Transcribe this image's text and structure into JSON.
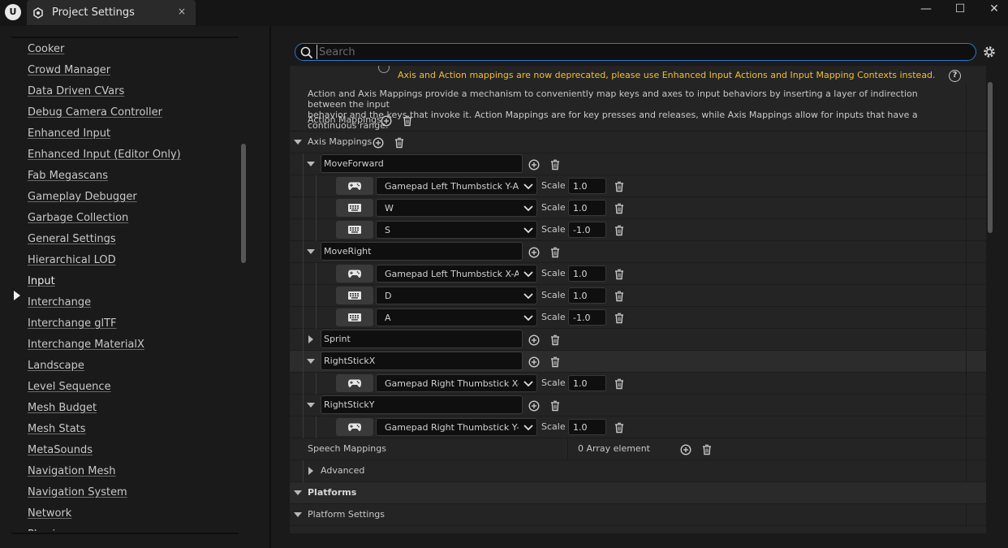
{
  "window": {
    "app_logo_text": "U",
    "tab_title": "Project Settings",
    "close_tab_glyph": "×",
    "minimize_glyph": "—",
    "maximize_glyph": "☐",
    "close_glyph": "✕"
  },
  "sidebar": {
    "selected": "Input",
    "items": [
      "Cooker",
      "Crowd Manager",
      "Data Driven CVars",
      "Debug Camera Controller",
      "Enhanced Input",
      "Enhanced Input (Editor Only)",
      "Fab Megascans",
      "Gameplay Debugger",
      "Garbage Collection",
      "General Settings",
      "Hierarchical LOD",
      "Input",
      "Interchange",
      "Interchange glTF",
      "Interchange MaterialX",
      "Landscape",
      "Level Sequence",
      "Mesh Budget",
      "Mesh Stats",
      "MetaSounds",
      "Navigation Mesh",
      "Navigation System",
      "Network",
      "Physics"
    ]
  },
  "search": {
    "placeholder": "Search",
    "value": ""
  },
  "details": {
    "deprecation_warning": "Axis and Action mappings are now deprecated, please use Enhanced Input Actions and Input Mapping Contexts instead.",
    "description_line1": "Action and Axis Mappings provide a mechanism to conveniently map keys and axes to input behaviors by inserting a layer of indirection between the input",
    "description_line2": "behavior and the keys that invoke it. Action Mappings are for key presses and releases, while Axis Mappings allow for inputs that have a continuous range.",
    "help_glyph": "?",
    "action_mappings_label": "Action Mappings",
    "axis_mappings_label": "Axis Mappings",
    "scale_label": "Scale",
    "axis_mappings": [
      {
        "name": "MoveForward",
        "expanded": true,
        "keys": [
          {
            "device": "gamepad",
            "key": "Gamepad Left Thumbstick Y-Axis",
            "scale": "1.0"
          },
          {
            "device": "keyboard",
            "key": "W",
            "scale": "1.0"
          },
          {
            "device": "keyboard",
            "key": "S",
            "scale": "-1.0"
          }
        ]
      },
      {
        "name": "MoveRight",
        "expanded": true,
        "keys": [
          {
            "device": "gamepad",
            "key": "Gamepad Left Thumbstick X-Axis",
            "scale": "1.0"
          },
          {
            "device": "keyboard",
            "key": "D",
            "scale": "1.0"
          },
          {
            "device": "keyboard",
            "key": "A",
            "scale": "-1.0"
          }
        ]
      },
      {
        "name": "Sprint",
        "expanded": false,
        "keys": []
      },
      {
        "name": "RightStickX",
        "expanded": true,
        "keys": [
          {
            "device": "gamepad",
            "key": "Gamepad Right Thumbstick X-Axis",
            "scale": "1.0"
          }
        ]
      },
      {
        "name": "RightStickY",
        "expanded": true,
        "keys": [
          {
            "device": "gamepad",
            "key": "Gamepad Right Thumbstick Y-Axis",
            "scale": "1.0"
          }
        ]
      }
    ],
    "speech_mappings_label": "Speech Mappings",
    "speech_mappings_value": "0 Array element",
    "advanced_label": "Advanced",
    "platforms_label": "Platforms",
    "platform_settings_label": "Platform Settings"
  },
  "colors": {
    "accent": "#2f78c8",
    "warning": "#f0c020",
    "background": "#1a1a1a",
    "panel": "#242424"
  }
}
